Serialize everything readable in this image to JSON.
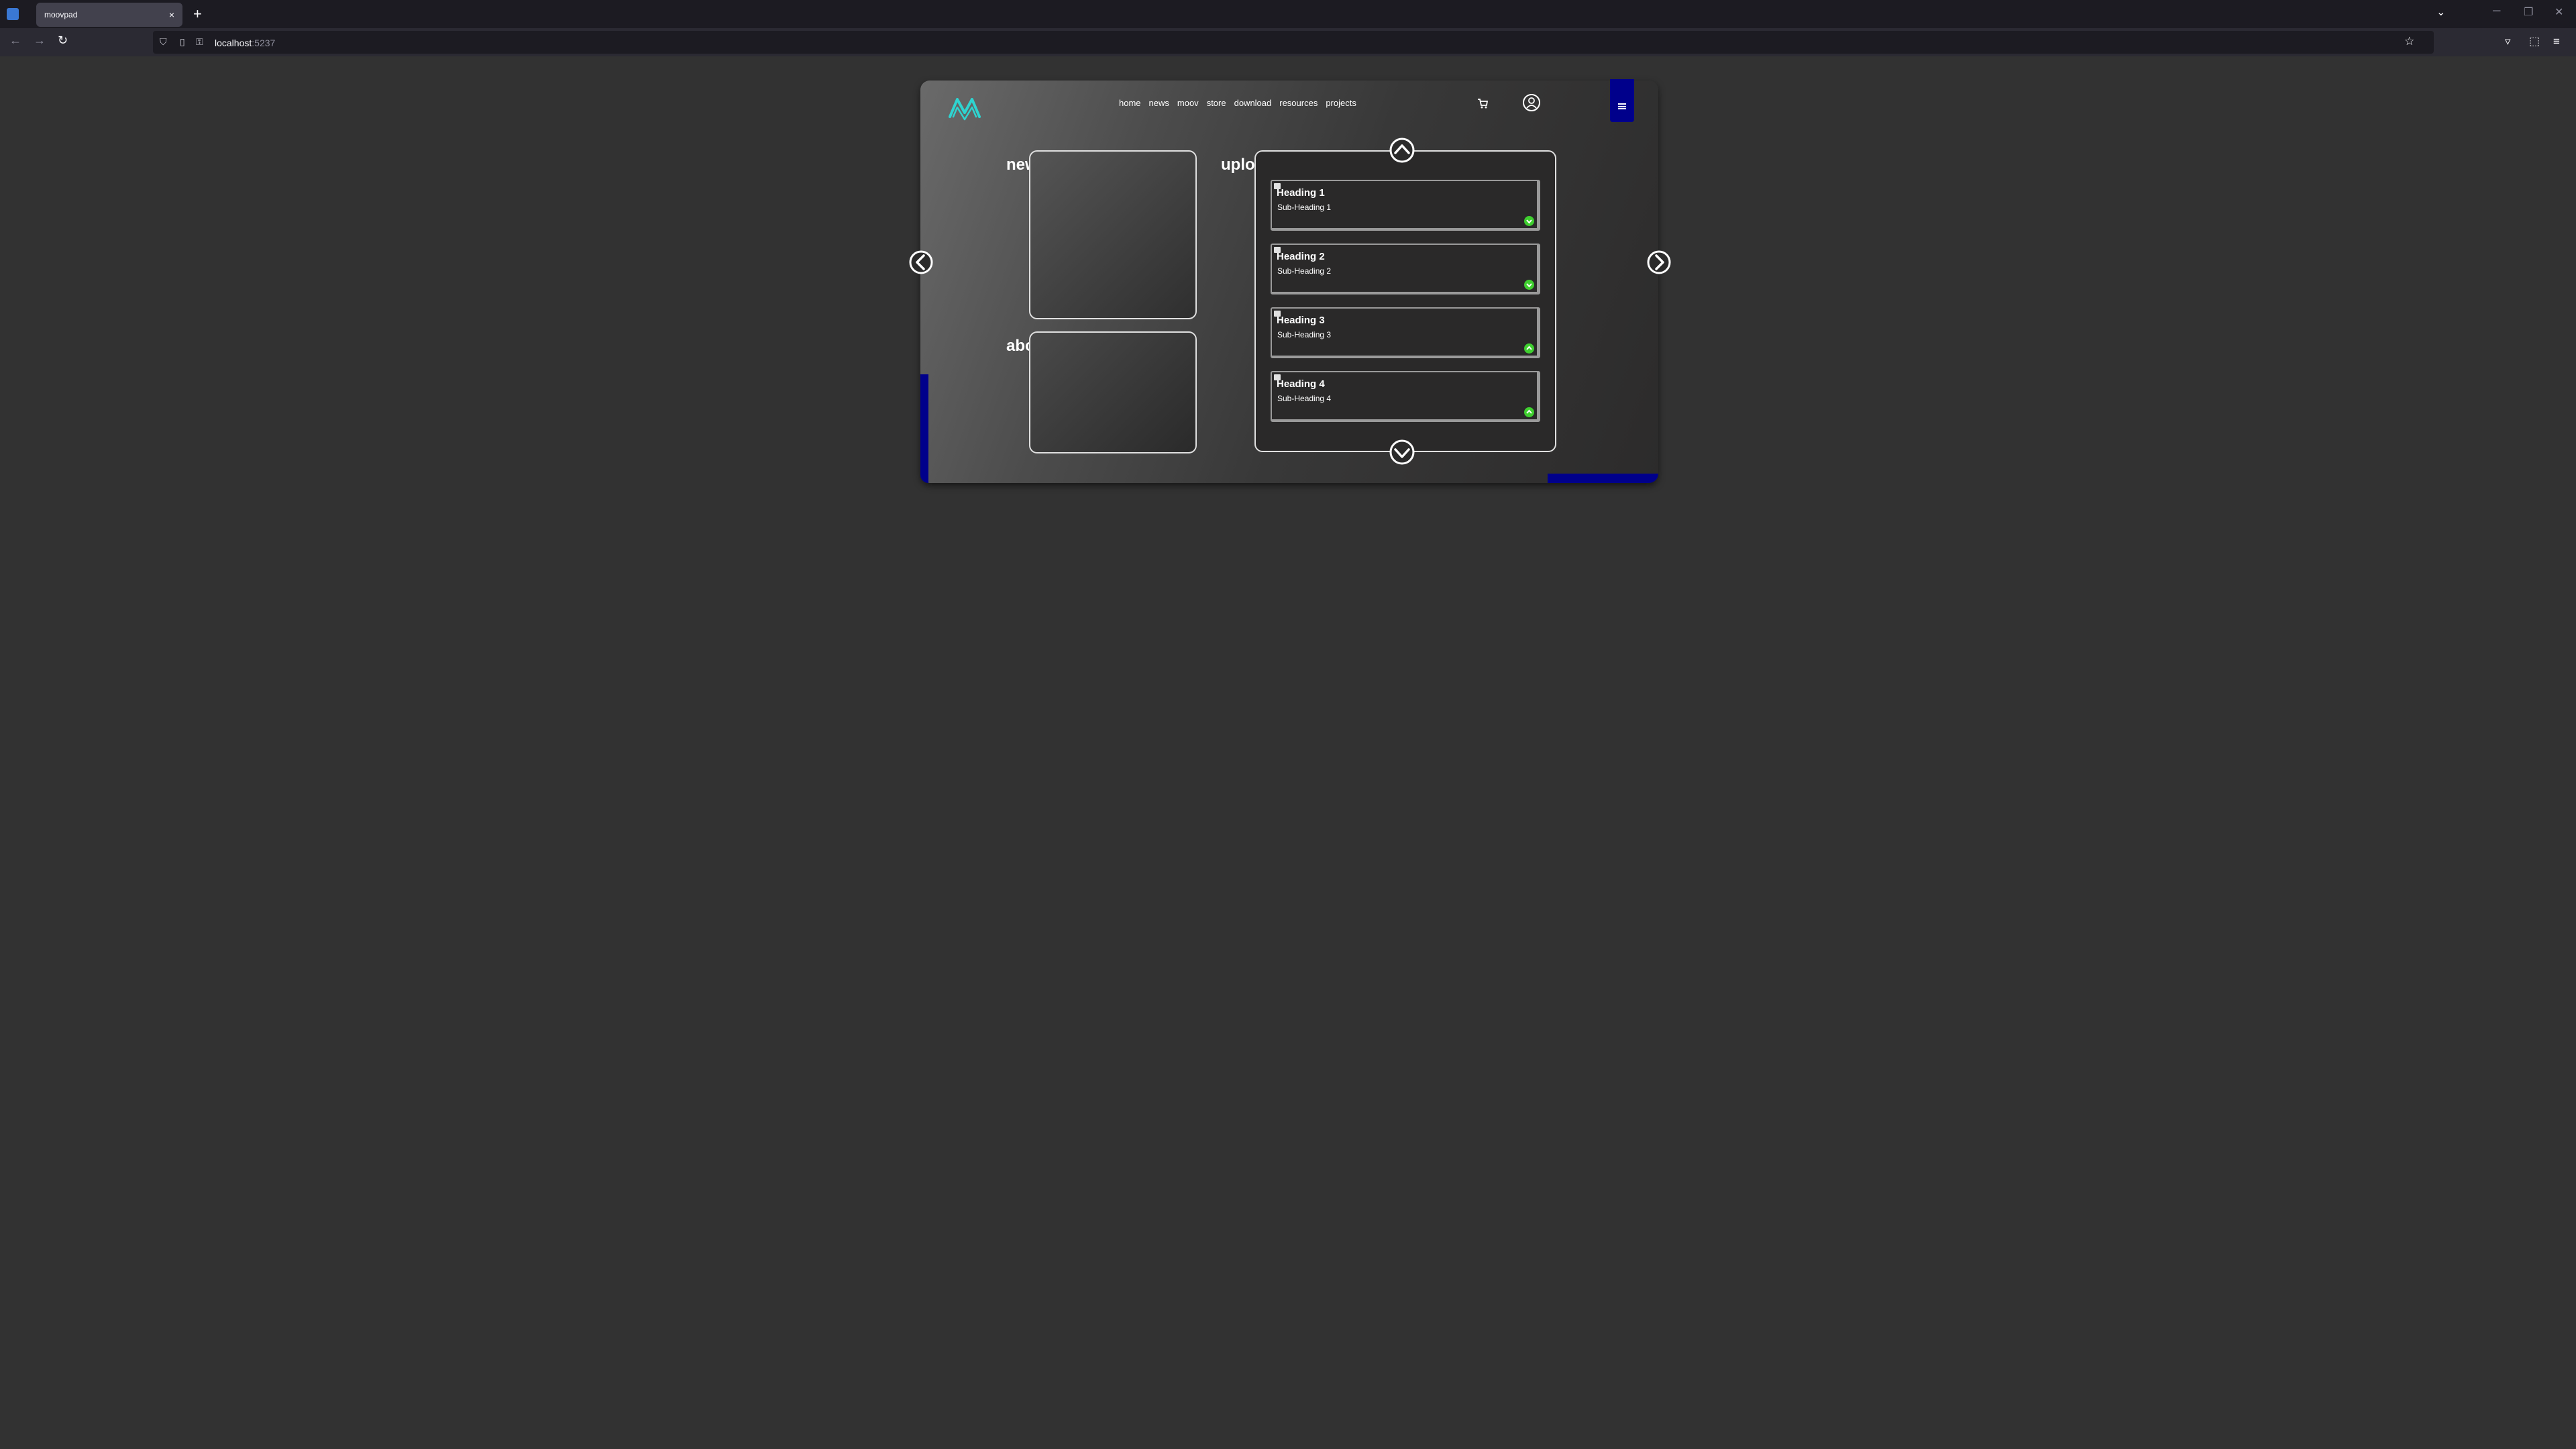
{
  "browser": {
    "tab_title": "moovpad",
    "tab_close": "×",
    "new_tab": "+",
    "url_host": "localhost",
    "url_port": ":5237"
  },
  "page": {
    "nav": [
      "home",
      "news",
      "moov",
      "store",
      "download",
      "resources",
      "projects"
    ],
    "sections": {
      "new_title": "new",
      "about_title": "about",
      "uploads_title": "uploads"
    },
    "uploads": [
      {
        "heading": "Heading 1",
        "sub": "Sub-Heading 1",
        "badge": "check"
      },
      {
        "heading": "Heading 2",
        "sub": "Sub-Heading 2",
        "badge": "check"
      },
      {
        "heading": "Heading 3",
        "sub": "Sub-Heading 3",
        "badge": "up"
      },
      {
        "heading": "Heading 4",
        "sub": "Sub-Heading 4",
        "badge": "up"
      }
    ]
  },
  "colors": {
    "accent_blue": "#00008b",
    "logo_teal": "#2ed4d0",
    "badge_green": "#3fcf2f"
  },
  "icons": [
    "logo-icon",
    "cart-icon",
    "user-icon",
    "menu-icon",
    "chevron-up-icon",
    "chevron-down-icon",
    "arrow-left-icon",
    "arrow-right-icon"
  ]
}
